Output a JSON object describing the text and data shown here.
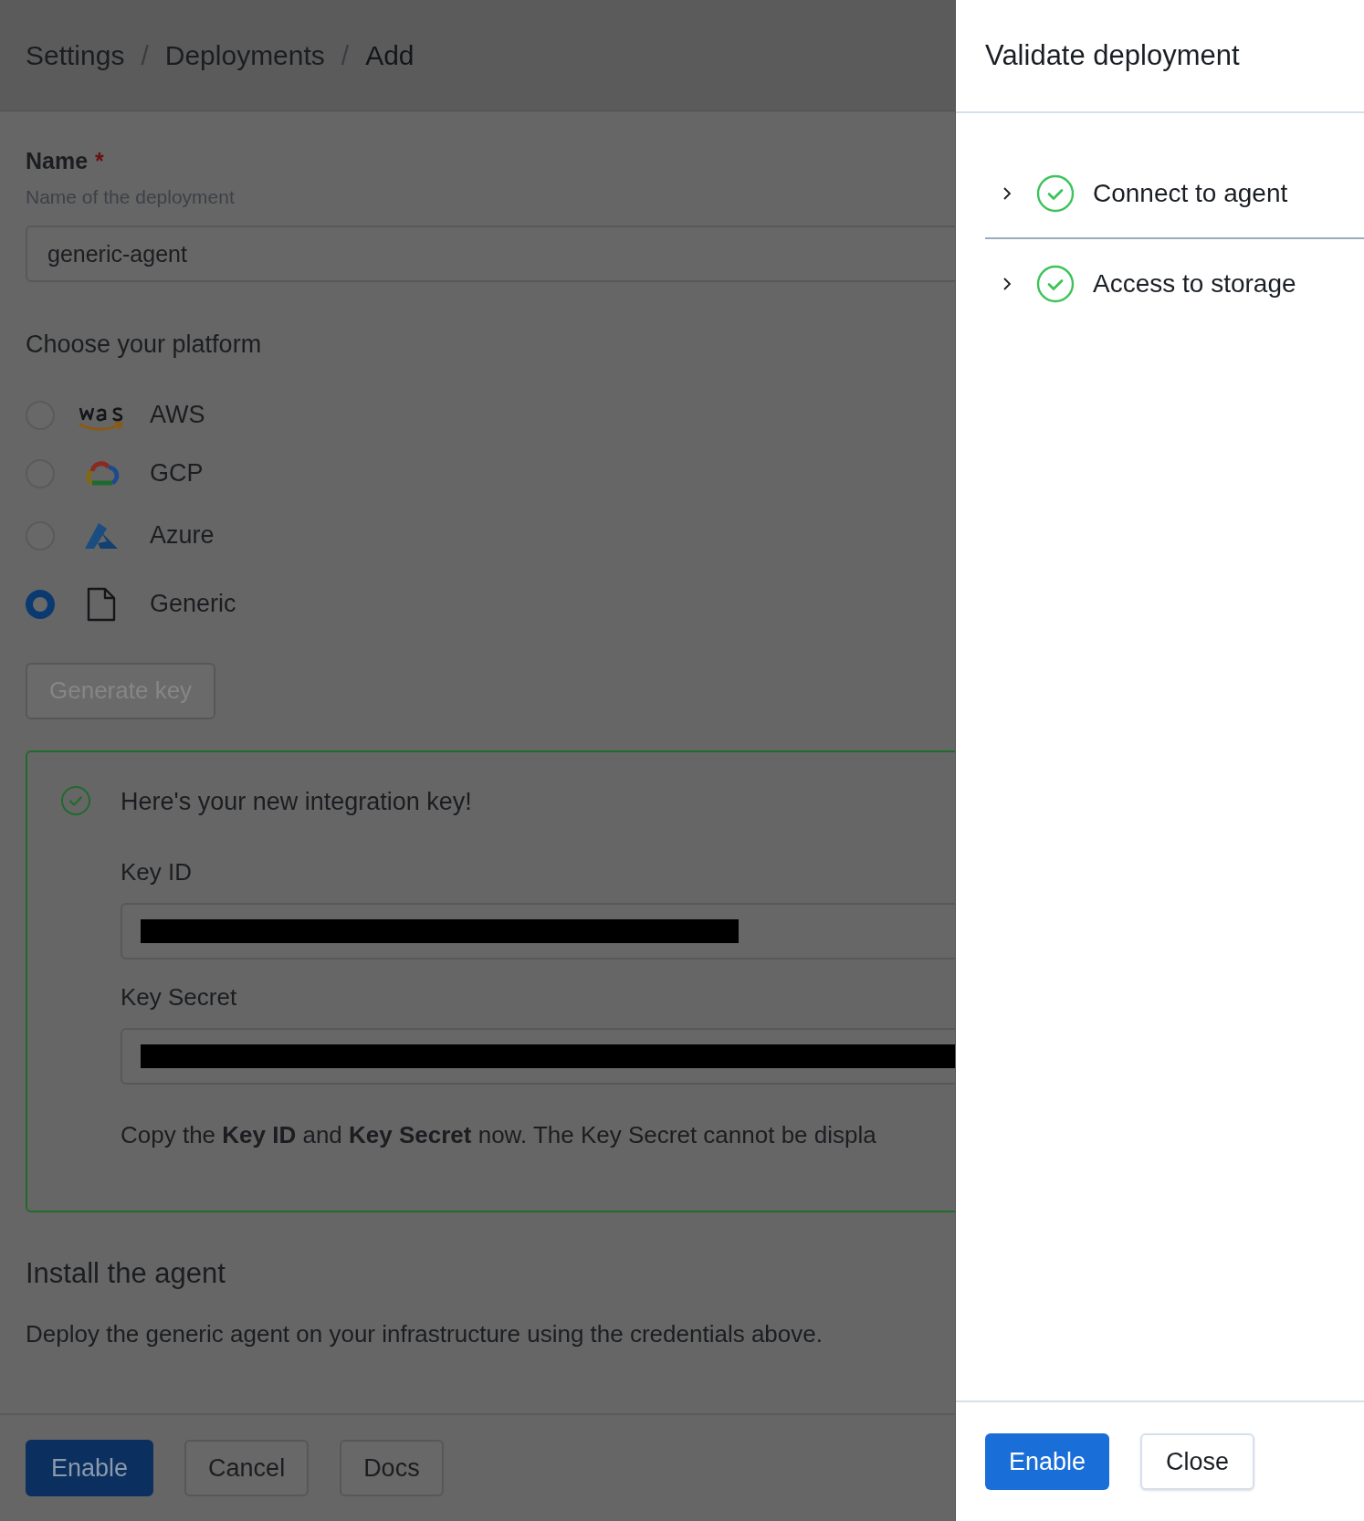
{
  "breadcrumb": [
    {
      "kind": "link",
      "label": "Settings"
    },
    {
      "kind": "separator",
      "label": "/"
    },
    {
      "kind": "link",
      "label": "Deployments"
    },
    {
      "kind": "separator",
      "label": "/"
    },
    {
      "kind": "current",
      "label": "Add"
    }
  ],
  "name_field": {
    "label": "Name",
    "required_mark": "*",
    "hint": "Name of the deployment",
    "value": "generic-agent"
  },
  "platform": {
    "heading": "Choose your platform",
    "options": [
      {
        "label": "AWS",
        "kind": "aws",
        "selected": false
      },
      {
        "label": "GCP",
        "kind": "gcp",
        "selected": false
      },
      {
        "label": "Azure",
        "kind": "azure",
        "selected": false
      },
      {
        "label": "Generic",
        "kind": "generic",
        "selected": true
      }
    ]
  },
  "generate_key_button": {
    "label": "Generate key",
    "disabled": true
  },
  "key_panel": {
    "title": "Here's your new integration key!",
    "fields": [
      {
        "label": "Key ID"
      },
      {
        "label": "Key Secret"
      }
    ],
    "note": "Copy the **Key ID** and **Key Secret** now. The Key Secret cannot be displa"
  },
  "install": {
    "heading": "Install the agent",
    "text": "Deploy the generic agent on your infrastructure using the credentials above."
  },
  "footer_buttons": [
    {
      "label": "Enable",
      "kind": "primary"
    },
    {
      "label": "Cancel",
      "kind": "secondary"
    },
    {
      "label": "Docs",
      "kind": "secondary"
    }
  ],
  "drawer": {
    "title": "Validate deployment",
    "checks": [
      {
        "label": "Connect to agent",
        "expanded": false,
        "passed": true
      },
      {
        "label": "Access to storage",
        "expanded": false,
        "passed": true
      }
    ],
    "buttons": [
      {
        "label": "Enable",
        "kind": "primary"
      },
      {
        "label": "Close",
        "kind": "secondary"
      }
    ]
  }
}
